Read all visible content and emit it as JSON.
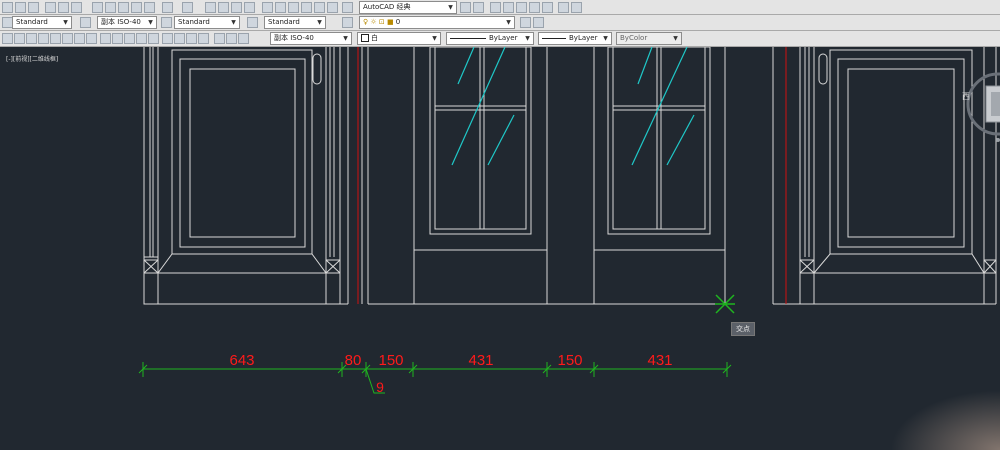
{
  "toolbar1": {
    "workspace": "AutoCAD 经典",
    "layer": "0"
  },
  "toolbar2": {
    "text_style": "Standard",
    "dim_style": "副本 ISO-40",
    "table_style": "Standard",
    "multileader_style": "Standard"
  },
  "toolbar3": {
    "dim_style": "副本 ISO-40",
    "color": "白",
    "linetype": "ByLayer",
    "lineweight": "ByLayer",
    "plotstyle": "ByColor"
  },
  "viewport": {
    "label": "[-][前视][二维线框]",
    "compass_label": "西",
    "tooltip": "交点"
  },
  "dimensions": {
    "d1": "643",
    "d2": "80",
    "d3": "150",
    "d4": "431",
    "d5": "150",
    "d6": "431",
    "d7": "9"
  },
  "colors": {
    "background": "#212830",
    "linework": "#d9d9d9",
    "dimension_line": "#1fb51f",
    "dimension_text": "#ff1a1a",
    "glass_hatch": "#1fc8c8",
    "center_line": "#d01010"
  }
}
